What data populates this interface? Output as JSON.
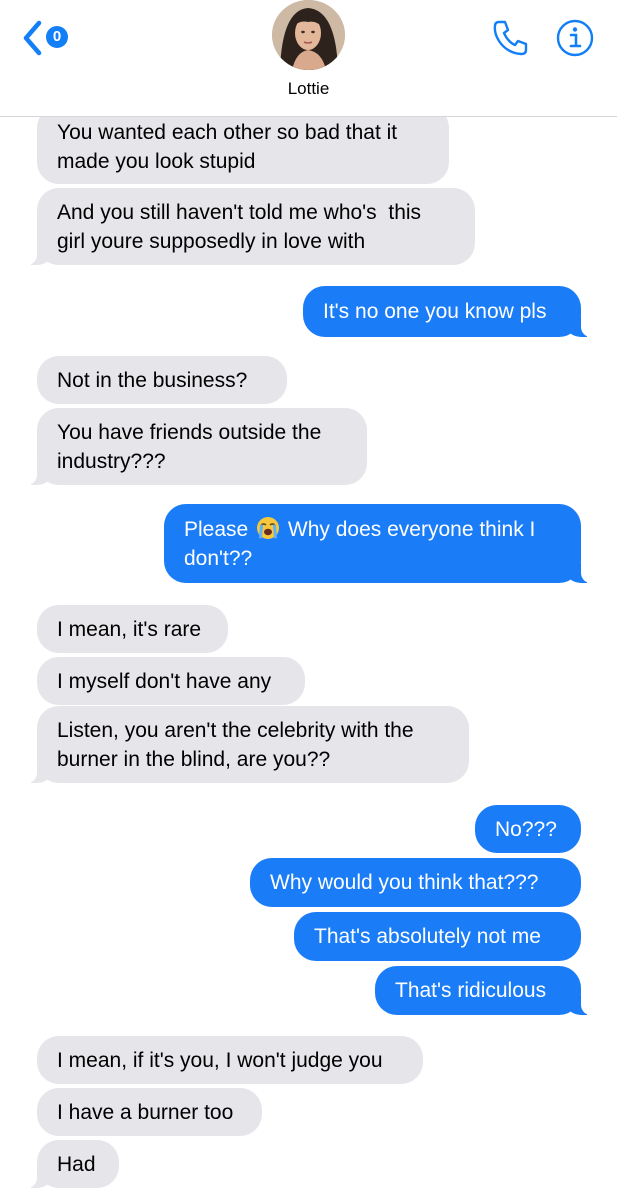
{
  "header": {
    "unread_count": "0",
    "contact_name": "Lottie",
    "icons": {
      "back": "chevron-left-icon",
      "call": "phone-icon",
      "info": "info-icon"
    },
    "accent_color": "#137ff7"
  },
  "colors": {
    "incoming_bubble": "#e5e5ea",
    "outgoing_bubble": "#1a7cf7"
  },
  "messages": [
    {
      "direction": "in",
      "text": "You wanted each other so bad that it\nmade you look stupid"
    },
    {
      "direction": "in",
      "text": "And you still haven't told me who's  this\ngirl youre supposedly in love with"
    },
    {
      "direction": "out",
      "text": "It's no one you know pls"
    },
    {
      "direction": "in",
      "text": "Not in the business?"
    },
    {
      "direction": "in",
      "text": "You have friends outside the\nindustry???"
    },
    {
      "direction": "out",
      "text_before": "Please",
      "emoji": "loudly-crying-face",
      "text_after": "Why does everyone think I\ndon't??"
    },
    {
      "direction": "in",
      "text": "I mean, it's rare"
    },
    {
      "direction": "in",
      "text": "I myself don't have any"
    },
    {
      "direction": "in",
      "text": "Listen, you aren't the celebrity with the\nburner in the blind, are you??"
    },
    {
      "direction": "out",
      "text": "No???"
    },
    {
      "direction": "out",
      "text": "Why would you think that???"
    },
    {
      "direction": "out",
      "text": "That's absolutely not me"
    },
    {
      "direction": "out",
      "text": "That's ridiculous"
    },
    {
      "direction": "in",
      "text": "I mean, if it's you, I won't judge you"
    },
    {
      "direction": "in",
      "text": "I have a burner too"
    },
    {
      "direction": "in",
      "text": "Had"
    }
  ]
}
